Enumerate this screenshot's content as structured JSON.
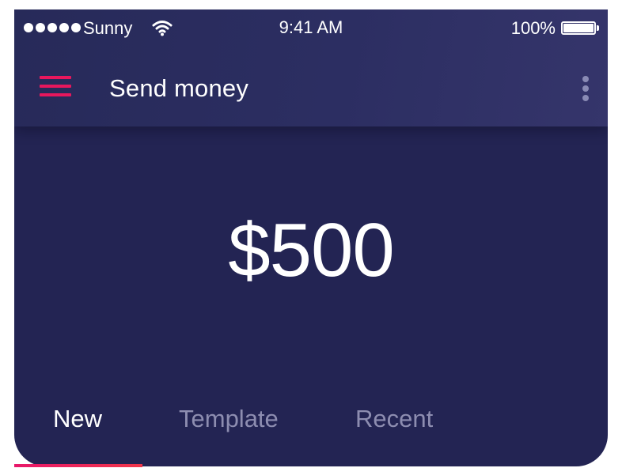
{
  "status_bar": {
    "carrier": "Sunny",
    "time": "9:41 AM",
    "battery_percent": "100%",
    "battery_level": 1.0,
    "signal_dots": 5
  },
  "app_bar": {
    "title": "Send money",
    "menu_icon": "hamburger-menu-icon",
    "more_icon": "more-vertical-icon"
  },
  "amount": {
    "display": "$500"
  },
  "tabs": [
    {
      "label": "New",
      "active": true
    },
    {
      "label": "Template",
      "active": false
    },
    {
      "label": "Recent",
      "active": false
    }
  ],
  "colors": {
    "background": "#232453",
    "app_bar": "#2c2e62",
    "accent": "#e8175d",
    "inactive_tab": "#8d8db0"
  }
}
